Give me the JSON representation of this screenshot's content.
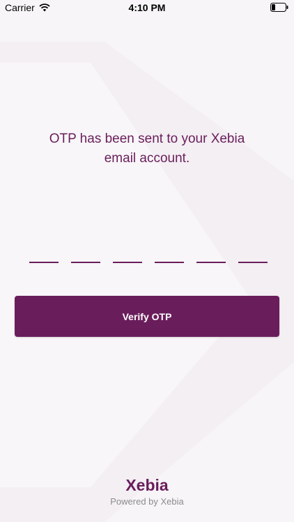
{
  "status_bar": {
    "carrier": "Carrier",
    "time": "4:10 PM"
  },
  "main": {
    "message_line1": "OTP has been sent to your Xebia",
    "message_line2": "email account.",
    "otp_slots": [
      "",
      "",
      "",
      "",
      "",
      ""
    ],
    "verify_label": "Verify OTP"
  },
  "footer": {
    "logo_text": "Xebia",
    "powered_by": "Powered by Xebia"
  },
  "colors": {
    "brand": "#6a1d5b",
    "background": "#f7f5f7",
    "muted": "#8c8c8c"
  }
}
